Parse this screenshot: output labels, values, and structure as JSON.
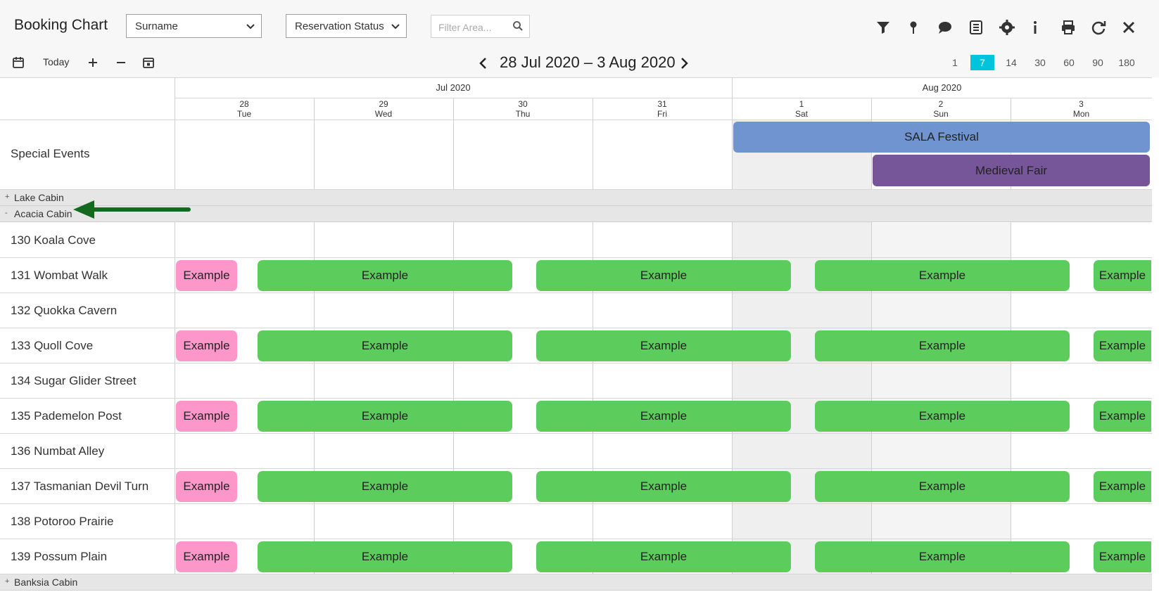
{
  "header": {
    "title": "Booking Chart",
    "sort_select": "Surname",
    "status_select": "Reservation Status",
    "filter_placeholder": "Filter Area...",
    "today_label": "Today",
    "date_range": "28 Jul 2020 – 3 Aug 2020",
    "zoom_options": [
      "1",
      "7",
      "14",
      "30",
      "60",
      "90",
      "180"
    ],
    "zoom_active": "7"
  },
  "calendar": {
    "months": [
      "Jul 2020",
      "Aug 2020"
    ],
    "days": [
      {
        "num": "28",
        "name": "Tue"
      },
      {
        "num": "29",
        "name": "Wed"
      },
      {
        "num": "30",
        "name": "Thu"
      },
      {
        "num": "31",
        "name": "Fri"
      },
      {
        "num": "1",
        "name": "Sat"
      },
      {
        "num": "2",
        "name": "Sun"
      },
      {
        "num": "3",
        "name": "Mon"
      }
    ]
  },
  "special_events": {
    "label": "Special Events",
    "events": [
      "SALA Festival",
      "Medieval Fair"
    ],
    "colors": {
      "sala": "#7094d0",
      "medieval": "#765598"
    }
  },
  "groups": [
    {
      "sign": "+",
      "name": "Lake Cabin"
    },
    {
      "sign": "-",
      "name": "Acacia Cabin"
    },
    {
      "sign": "+",
      "name": "Banksia Cabin"
    }
  ],
  "rooms": [
    "130 Koala Cove",
    "131 Wombat Walk",
    "132 Quokka Cavern",
    "133 Quoll Cove",
    "134 Sugar Glider Street",
    "135 Pademelon Post",
    "136 Numbat Alley",
    "137 Tasmanian Devil Turn",
    "138 Potoroo Prairie",
    "139 Possum Plain"
  ],
  "booking_label": "Example",
  "colors": {
    "pink": "#fd96c9",
    "green": "#5ccd5c",
    "accent": "#00c3dc",
    "arrow": "#15691f"
  }
}
